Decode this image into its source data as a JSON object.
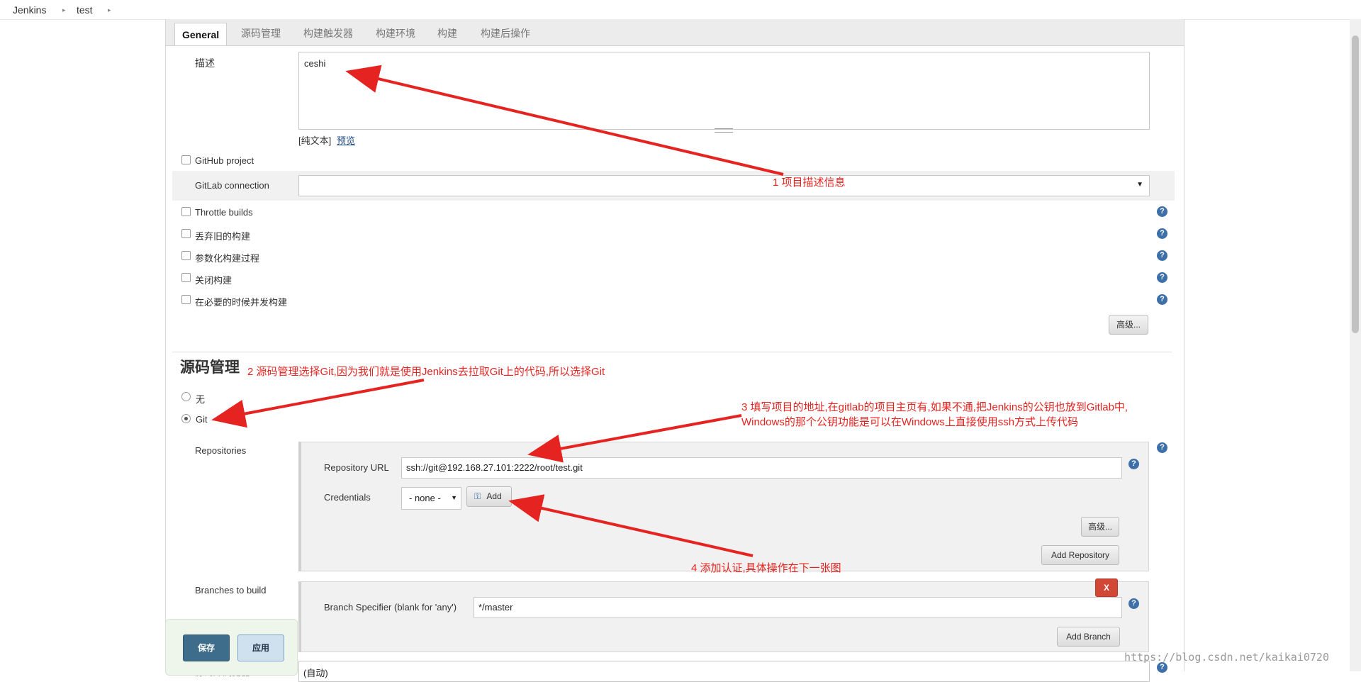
{
  "breadcrumb": {
    "root": "Jenkins",
    "job": "test"
  },
  "tabs": [
    "General",
    "源码管理",
    "构建触发器",
    "构建环境",
    "构建",
    "构建后操作"
  ],
  "general": {
    "description_label": "描述",
    "description_value": "ceshi",
    "plain_text": "[纯文本]",
    "preview_link": "预览",
    "github_project": "GitHub project",
    "gitlab_connection": "GitLab connection",
    "options": [
      "Throttle builds",
      "丢弃旧的构建",
      "参数化构建过程",
      "关闭构建",
      "在必要的时候并发构建"
    ],
    "advanced_button": "高级..."
  },
  "scm": {
    "title": "源码管理",
    "none_option": "无",
    "git_option": "Git",
    "repositories_label": "Repositories",
    "repo_url_label": "Repository URL",
    "repo_url_value": "ssh://git@192.168.27.101:2222/root/test.git",
    "credentials_label": "Credentials",
    "credentials_value": "- none -",
    "add_button": "Add",
    "advanced_button": "高级...",
    "add_repository_button": "Add Repository",
    "branches_label": "Branches to build",
    "branch_specifier_label": "Branch Specifier (blank for 'any')",
    "branch_specifier_value": "*/master",
    "delete_button": "X",
    "add_branch_button": "Add Branch",
    "browser_label": "源码库浏览器",
    "browser_value": "(自动)"
  },
  "footer": {
    "save_button": "保存",
    "apply_button": "应用"
  },
  "annotations": {
    "a1": "1 项目描述信息",
    "a2": "2 源码管理选择Git,因为我们就是使用Jenkins去拉取Git上的代码,所以选择Git",
    "a3_line1": "3 填写项目的地址,在gitlab的项目主页有,如果不通,把Jenkins的公钥也放到Gitlab中,",
    "a3_line2": "Windows的那个公钥功能是可以在Windows上直接使用ssh方式上传代码",
    "a4": "4 添加认证,具体操作在下一张图"
  },
  "watermark": "https://blog.csdn.net/kaikai0720",
  "colors": {
    "annotation": "#e52421",
    "help_icon": "#3d6fa8",
    "save_button": "#3d6d8a",
    "delete_button": "#d24836"
  }
}
